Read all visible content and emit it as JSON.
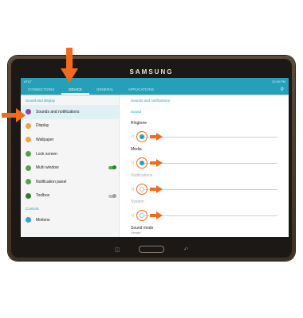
{
  "device": {
    "brand": "SAMSUNG"
  },
  "status": {
    "carrier": "AT&T",
    "time": "12:45 PM"
  },
  "tabs": [
    "CONNECTIONS",
    "DEVICE",
    "GENERAL",
    "APPLICATIONS"
  ],
  "active_tab_index": 1,
  "sidebar": {
    "section1": "Sound and display",
    "items": [
      {
        "label": "Sounds and notifications",
        "icon": "speaker-icon",
        "color": "#8e44ad"
      },
      {
        "label": "Display",
        "icon": "display-icon",
        "color": "#f2a33a"
      },
      {
        "label": "Wallpaper",
        "icon": "wallpaper-icon",
        "color": "#f2a33a"
      },
      {
        "label": "Lock screen",
        "icon": "lock-icon",
        "color": "#5aa04a"
      },
      {
        "label": "Multi window",
        "icon": "multiwindow-icon",
        "color": "#5aa04a"
      },
      {
        "label": "Notification panel",
        "icon": "notification-icon",
        "color": "#5aa04a"
      },
      {
        "label": "Toolbox",
        "icon": "toolbox-icon",
        "color": "#2e7d32"
      }
    ],
    "section2": "Controls",
    "items2": [
      {
        "label": "Motions",
        "icon": "motions-icon",
        "color": "#3aa0d8"
      }
    ]
  },
  "main": {
    "title": "Sounds and notifications",
    "sound_header": "Sound",
    "sliders": [
      {
        "label": "Ringtone",
        "level": 0.03,
        "enabled": true
      },
      {
        "label": "Media",
        "level": 0.03,
        "enabled": true
      },
      {
        "label": "Notifications",
        "level": 0.03,
        "enabled": false
      },
      {
        "label": "System",
        "level": 0.03,
        "enabled": false
      }
    ],
    "sound_mode": {
      "label": "Sound mode",
      "value": "Vibrate"
    }
  },
  "colors": {
    "accent": "#26a0b9",
    "arrow": "#f26a1b"
  }
}
